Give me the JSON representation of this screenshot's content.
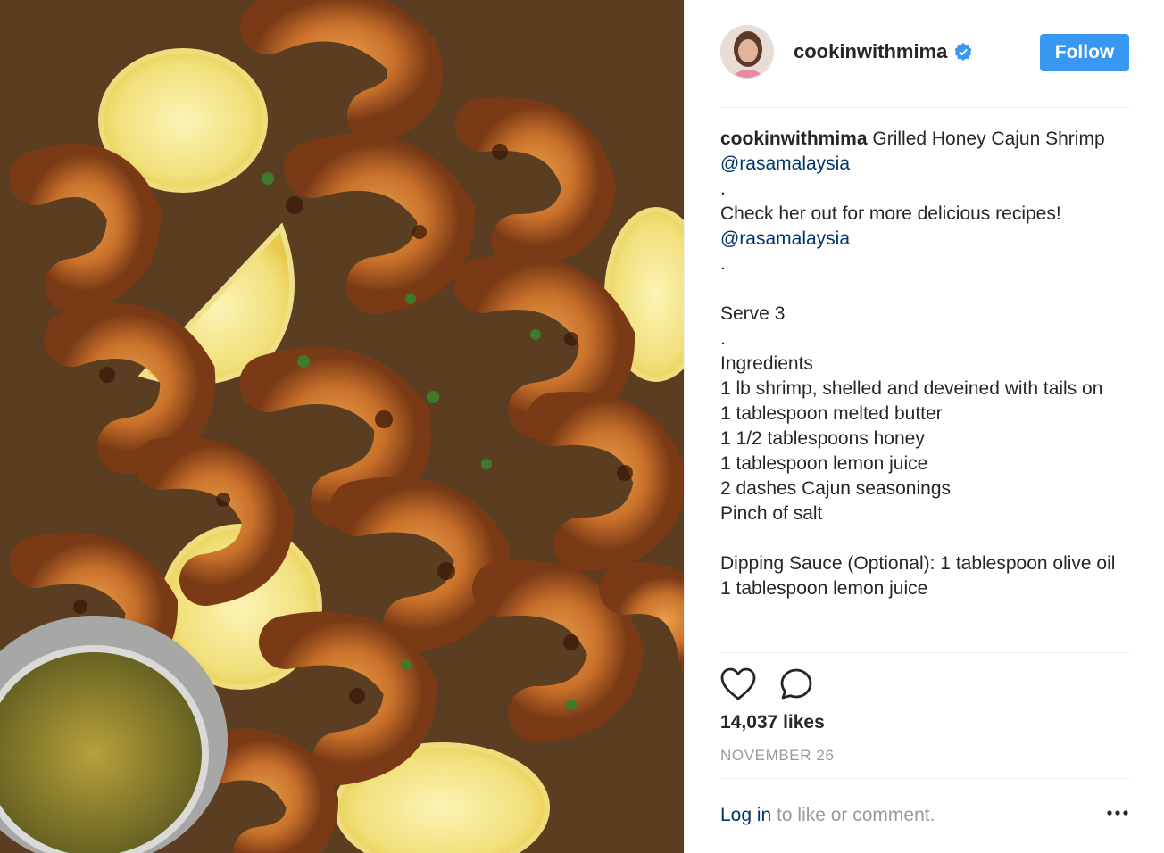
{
  "photo": {
    "alt": "Grilled honey cajun shrimp with lemon slices"
  },
  "header": {
    "username": "cookinwithmima",
    "verified_icon": "verified-badge-icon",
    "follow_label": "Follow",
    "accent": "#3897f0"
  },
  "caption": {
    "username": "cookinwithmima",
    "line1_text": " Grilled Honey Cajun Shrimp ",
    "mention1": "@rasamalaysia",
    "dot1": ".",
    "line3": "Check her out for more delicious recipes!",
    "mention2": "@rasamalaysia",
    "dot2": ".",
    "serve": "Serve 3",
    "dot3": ".",
    "ingredients_heading": "Ingredients",
    "ingredients": [
      "1 lb shrimp, shelled and deveined with tails on",
      "1 tablespoon melted butter",
      "1 1/2 tablespoons honey",
      "1 tablespoon lemon juice",
      "2 dashes Cajun seasonings",
      "Pinch of salt"
    ],
    "dipping_sauce": "Dipping Sauce (Optional): 1 tablespoon olive oil",
    "dipping_line2": "1 tablespoon lemon juice"
  },
  "actions": {
    "like_icon": "heart-icon",
    "comment_icon": "comment-icon"
  },
  "likes": "14,037 likes",
  "date": "NOVEMBER 26",
  "footer": {
    "login_link": "Log in",
    "rest_text": " to like or comment.",
    "more_icon": "more-options-icon"
  }
}
